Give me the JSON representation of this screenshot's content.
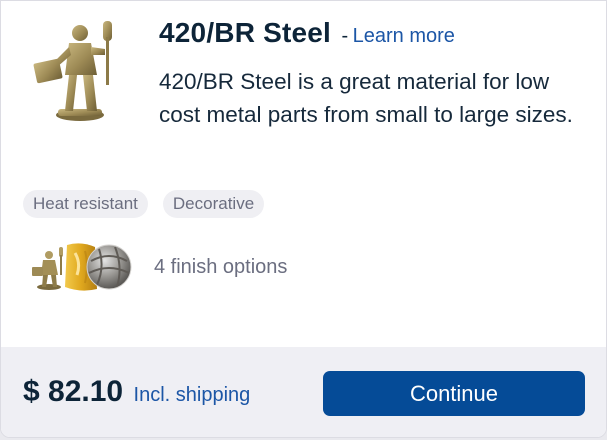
{
  "material": {
    "name": "420/BR Steel",
    "separator": "-",
    "learn_more": "Learn more",
    "description": "420/BR Steel is a great material for low cost metal parts from small to large sizes.",
    "image_icon": "bronze-figurine-image"
  },
  "tags": [
    {
      "label": "Heat resistant"
    },
    {
      "label": "Decorative"
    }
  ],
  "finishes": {
    "label": "4 finish options",
    "swatch_icons": [
      "bronze-figurine-swatch",
      "gold-finish-swatch",
      "steel-ball-swatch"
    ]
  },
  "footer": {
    "price": "$ 82.10",
    "price_note": "Incl. shipping",
    "continue_label": "Continue"
  },
  "colors": {
    "accent": "#054b97",
    "link": "#1c56a6",
    "title": "#0d2438",
    "muted": "#6b6e80",
    "bronze": "#9d8a55"
  }
}
